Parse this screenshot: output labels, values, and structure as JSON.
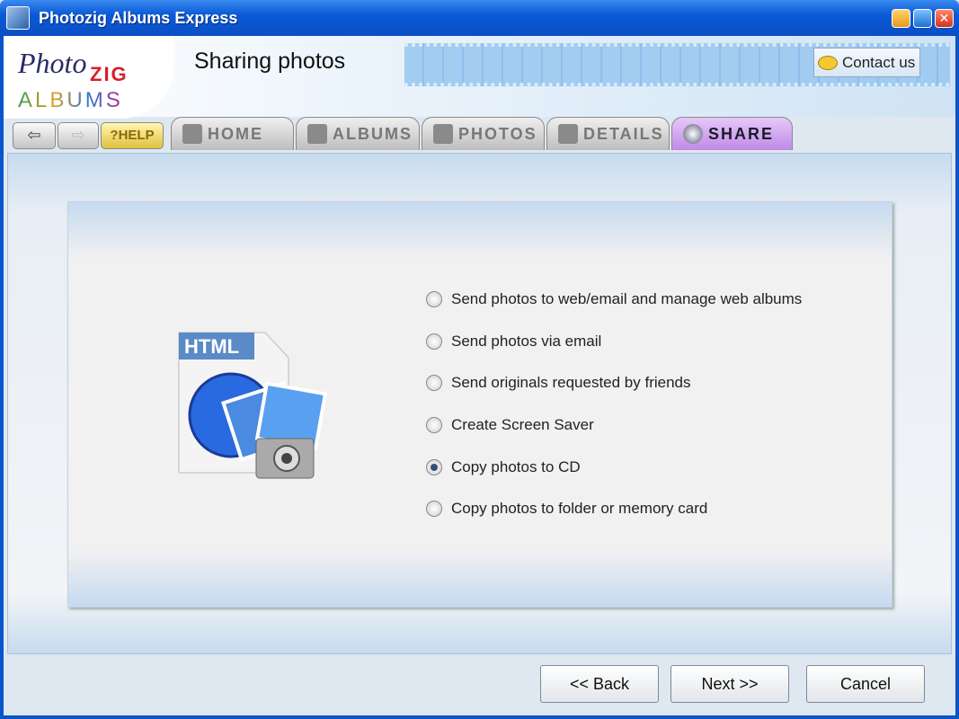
{
  "window": {
    "title": "Photozig Albums Express",
    "minimize": "_",
    "maximize": "□",
    "close": "✕"
  },
  "header": {
    "logo": {
      "photo": "Photo",
      "zig": "ZIG",
      "albums": "ALBUMS"
    },
    "page_title": "Sharing photos",
    "contact_label": "Contact us"
  },
  "nav": {
    "back": "⇦",
    "forward": "⇨",
    "help": "?HELP"
  },
  "tabs": [
    {
      "label": "HOME",
      "icon": "home-icon"
    },
    {
      "label": "ALBUMS",
      "icon": "album-icon"
    },
    {
      "label": "PHOTOS",
      "icon": "grid-icon"
    },
    {
      "label": "DETAILS",
      "icon": "person-icon"
    },
    {
      "label": "SHARE",
      "icon": "globe-icon",
      "active": true
    }
  ],
  "illustration": {
    "label": "HTML"
  },
  "options": [
    {
      "label": "Send photos to web/email and manage web albums",
      "selected": false
    },
    {
      "label": "Send photos via email",
      "selected": false
    },
    {
      "label": "Send originals requested by friends",
      "selected": false
    },
    {
      "label": "Create Screen Saver",
      "selected": false
    },
    {
      "label": "Copy photos to CD",
      "selected": true
    },
    {
      "label": "Copy photos to folder or memory card",
      "selected": false
    }
  ],
  "footer": {
    "back": "<< Back",
    "next": "Next >>",
    "cancel": "Cancel"
  },
  "colors": {
    "titlebar": "#0a5ad8",
    "active_tab": "#c08ae8"
  }
}
